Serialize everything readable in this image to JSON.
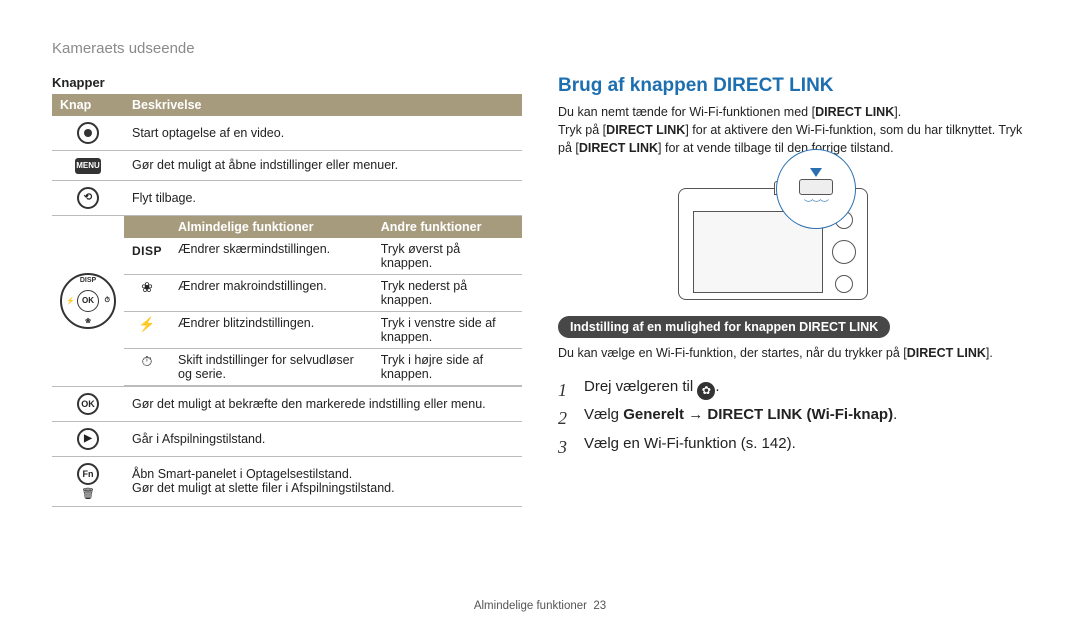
{
  "page_head": "Kameraets udseende",
  "left": {
    "section_title": "Knapper",
    "head_col1": "Knap",
    "head_col2": "Beskrivelse",
    "rows_top": [
      {
        "icon": "record",
        "desc": "Start optagelse af en video."
      },
      {
        "icon": "menu",
        "desc": "Gør det muligt at åbne indstillinger eller menuer."
      },
      {
        "icon": "back",
        "desc": "Flyt tilbage."
      }
    ],
    "sub_head1": "Almindelige funktioner",
    "sub_head2": "Andre funktioner",
    "disp_label": "DISP",
    "dpad_center": "OK",
    "sub_rows": [
      {
        "icon": "disp",
        "c1": "Ændrer skærmindstillingen.",
        "c2": "Tryk øverst på knappen."
      },
      {
        "icon": "macro",
        "c1": "Ændrer makroindstillingen.",
        "c2": "Tryk nederst på knappen."
      },
      {
        "icon": "flash",
        "c1": "Ændrer blitzindstillingen.",
        "c2": "Tryk i venstre side af knappen."
      },
      {
        "icon": "timer",
        "c1": "Skift indstillinger for selvudløser og serie.",
        "c2": "Tryk i højre side af knappen."
      }
    ],
    "rows_bottom": [
      {
        "icon": "ok",
        "desc": "Gør det muligt at bekræfte den markerede indstilling eller menu."
      },
      {
        "icon": "play",
        "desc": "Går i Afspilningstilstand."
      },
      {
        "icon": "fn",
        "desc1": "Åbn Smart-panelet i Optagelsestilstand.",
        "desc2": "Gør det muligt at slette filer i Afspilningstilstand."
      }
    ]
  },
  "right": {
    "title": "Brug af knappen DIRECT LINK",
    "intro_1a": "Du kan nemt tænde for Wi-Fi-funktionen med [",
    "intro_1b": "DIRECT LINK",
    "intro_1c": "].",
    "intro_2a": "Tryk på [",
    "intro_2b": "DIRECT LINK",
    "intro_2c": "] for at aktivere den Wi-Fi-funktion, som du har tilknyttet. Tryk på [",
    "intro_2d": "DIRECT LINK",
    "intro_2e": "] for at vende tilbage til den forrige tilstand.",
    "pill": "Indstilling af en mulighed for knappen DIRECT LINK",
    "sub_1a": "Du kan vælge en Wi-Fi-funktion, der startes, når du trykker på [",
    "sub_1b": "DIRECT LINK",
    "sub_1c": "].",
    "step1": "Drej vælgeren til ",
    "step1_end": ".",
    "step2_a": "Vælg ",
    "step2_b": "Generelt",
    "step2_arrow": " → ",
    "step2_c": "DIRECT LINK (Wi-Fi-knap)",
    "step2_d": ".",
    "step3": "Vælg en Wi-Fi-funktion (s. 142)."
  },
  "footer_a": "Almindelige funktioner",
  "footer_b": "23"
}
